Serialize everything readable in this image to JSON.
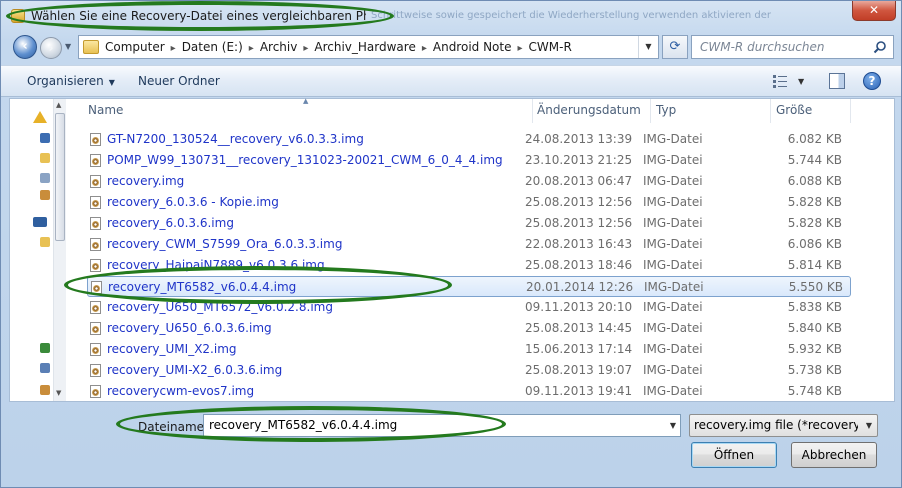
{
  "window": {
    "title": "Wählen Sie eine Recovery-Datei eines vergleichbaren Phones...",
    "title_ghost": "Schrittweise sowie gespeichert die Wiederherstellung verwenden aktivieren der",
    "close_symbol": "✕"
  },
  "address_bar": {
    "crumbs": [
      "Computer",
      "Daten (E:)",
      "Archiv",
      "Archiv_Hardware",
      "Android Note",
      "CWM-R"
    ],
    "separator": "▸",
    "search_placeholder": "CWM-R durchsuchen"
  },
  "toolbar": {
    "organize_label": "Organisieren",
    "new_folder_label": "Neuer Ordner",
    "help_symbol": "?"
  },
  "columns": {
    "name": "Name",
    "date": "Änderungsdatum",
    "type": "Typ",
    "size": "Größe"
  },
  "files": [
    {
      "name": "GT-N7200_130524__recovery_v6.0.3.3.img",
      "date": "24.08.2013 13:39",
      "type": "IMG-Datei",
      "size": "6.082 KB"
    },
    {
      "name": "POMP_W99_130731__recovery_131023-20021_CWM_6_0_4_4.img",
      "date": "23.10.2013 21:25",
      "type": "IMG-Datei",
      "size": "5.744 KB"
    },
    {
      "name": "recovery.img",
      "date": "20.08.2013 06:47",
      "type": "IMG-Datei",
      "size": "6.088 KB"
    },
    {
      "name": "recovery_6.0.3.6 - Kopie.img",
      "date": "25.08.2013 12:56",
      "type": "IMG-Datei",
      "size": "5.828 KB"
    },
    {
      "name": "recovery_6.0.3.6.img",
      "date": "25.08.2013 12:56",
      "type": "IMG-Datei",
      "size": "5.828 KB"
    },
    {
      "name": "recovery_CWM_S7599_Ora_6.0.3.3.img",
      "date": "22.08.2013 16:43",
      "type": "IMG-Datei",
      "size": "6.086 KB"
    },
    {
      "name": "recovery_HaipaiN7889_v6.0.3.6.img",
      "date": "25.08.2013 18:46",
      "type": "IMG-Datei",
      "size": "5.814 KB"
    },
    {
      "name": "recovery_MT6582_v6.0.4.4.img",
      "date": "20.01.2014 12:26",
      "type": "IMG-Datei",
      "size": "5.550 KB",
      "selected": true
    },
    {
      "name": "recovery_U650_MT6572_v6.0.2.8.img",
      "date": "09.11.2013 20:10",
      "type": "IMG-Datei",
      "size": "5.838 KB"
    },
    {
      "name": "recovery_U650_6.0.3.6.img",
      "date": "25.08.2013 14:45",
      "type": "IMG-Datei",
      "size": "5.840 KB"
    },
    {
      "name": "recovery_UMI_X2.img",
      "date": "15.06.2013 17:14",
      "type": "IMG-Datei",
      "size": "5.932 KB"
    },
    {
      "name": "recovery_UMI-X2_6.0.3.6.img",
      "date": "25.08.2013 19:07",
      "type": "IMG-Datei",
      "size": "5.738 KB"
    },
    {
      "name": "recoverycwm-evos7.img",
      "date": "09.11.2013 19:41",
      "type": "IMG-Datei",
      "size": "5.748 KB"
    }
  ],
  "footer": {
    "filename_label": "Dateiname:",
    "filename_value": "recovery_MT6582_v6.0.4.4.img",
    "filter_value": "recovery.img file (*recovery*.img)",
    "open_label": "Öffnen",
    "cancel_label": "Abbrechen"
  },
  "colors": {
    "annotation": "#247a1e",
    "link_text": "#1f34c8",
    "selection_border": "#7da2ce"
  }
}
